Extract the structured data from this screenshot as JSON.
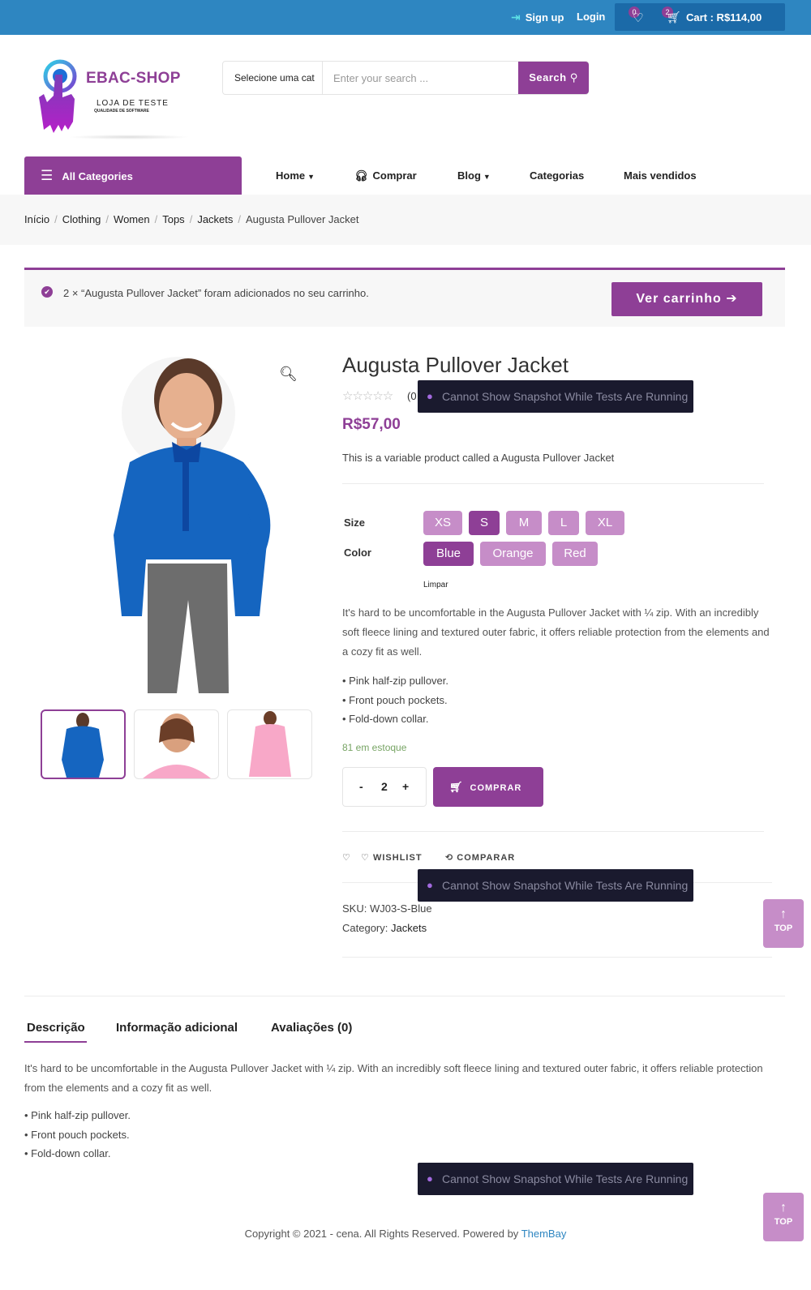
{
  "topbar": {
    "signup_label": "Sign up",
    "login_label": "Login",
    "wishlist_count": "0",
    "cart_count": "2",
    "cart_label": "Cart : R$114,00"
  },
  "header": {
    "brand": "EBAC-SHOP",
    "tagline": "LOJA DE TESTE",
    "subtagline": "QUALIDADE DE SOFTWARE",
    "category_select": "Selecione uma cat",
    "search_placeholder": "Enter your search ...",
    "search_button": "Search"
  },
  "nav": {
    "all_categories": "All Categories",
    "items": [
      "Home",
      "Comprar",
      "Blog",
      "Categorias",
      "Mais vendidos"
    ]
  },
  "breadcrumb": [
    "Início",
    "Clothing",
    "Women",
    "Tops",
    "Jackets",
    "Augusta Pullover Jacket"
  ],
  "notice": {
    "message": "2 × “Augusta Pullover Jacket” foram adicionados no seu carrinho.",
    "button": "Ver carrinho"
  },
  "product": {
    "title": "Augusta Pullover Jacket",
    "review_count": "(0",
    "price": "R$57,00",
    "short_description": "This is a variable product called a Augusta Pullover Jacket",
    "size_label": "Size",
    "sizes": [
      "XS",
      "S",
      "M",
      "L",
      "XL"
    ],
    "selected_size": "S",
    "color_label": "Color",
    "colors": [
      "Blue",
      "Orange",
      "Red"
    ],
    "selected_color": "Blue",
    "clear_label": "Limpar",
    "description": "It's hard to be uncomfortable in the Augusta Pullover Jacket with ¼ zip. With an incredibly soft fleece lining and textured outer fabric, it offers reliable protection from the elements and a cozy fit as well.",
    "bullets": [
      "• Pink half-zip pullover.",
      "• Front pouch pockets.",
      "• Fold-down collar."
    ],
    "stock": "81 em estoque",
    "qty_minus": "-",
    "quantity": "2",
    "qty_plus": "+",
    "buy_label": "COMPRAR",
    "wishlist_label": "WISHLIST",
    "compare_label": "COMPARAR",
    "sku_label": "SKU:",
    "sku": "WJ03-S-Blue",
    "category_label": "Category:",
    "category": "Jackets"
  },
  "overlay": {
    "snapshot_message": "Cannot Show Snapshot While Tests Are Running"
  },
  "top_button": "TOP",
  "tabs": {
    "items": [
      "Descrição",
      "Informação adicional",
      "Avaliações (0)"
    ],
    "active": "Descrição",
    "description": "It's hard to be uncomfortable in the Augusta Pullover Jacket with ¼ zip. With an incredibly soft fleece lining and textured outer fabric, it offers reliable protection from the elements and a cozy fit as well.",
    "bullets": [
      "• Pink half-zip pullover.",
      "• Front pouch pockets.",
      "• Fold-down collar."
    ]
  },
  "footer": {
    "text": "Copyright © 2021 - cena. All Rights Reserved. Powered by ",
    "link": "ThemBay"
  },
  "colors": {
    "topbar": "#2e86c1",
    "accent": "#8e3f96",
    "swatch": "#c68dc8",
    "stock": "#77a464"
  }
}
